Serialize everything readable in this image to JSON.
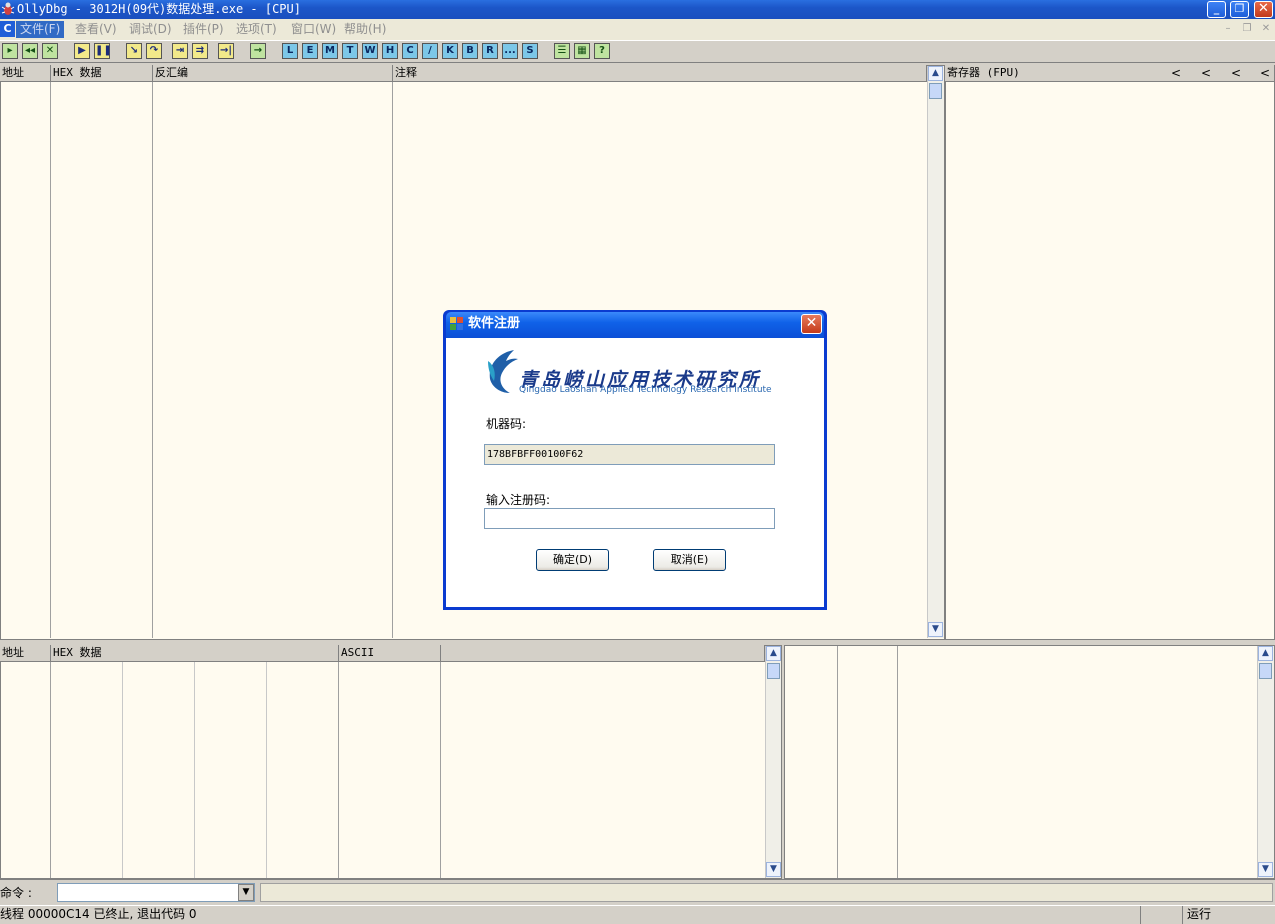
{
  "window": {
    "title": "OllyDbg - 3012H(09代)数据处理.exe - [CPU]",
    "buttons": {
      "minimize": "_",
      "restore": "❐",
      "close": "✕"
    }
  },
  "menu": {
    "mdi_icon": "C",
    "items": [
      "文件(F)",
      "查看(V)",
      "调试(D)",
      "插件(P)",
      "选项(T)",
      "窗口(W)",
      "帮助(H)"
    ],
    "mdi_controls": [
      "–",
      "❐",
      "✕"
    ]
  },
  "toolbar": {
    "buttons": [
      {
        "label": "▸",
        "name": "open-icon"
      },
      {
        "label": "◂◂",
        "name": "restart-icon"
      },
      {
        "label": "✕",
        "name": "close-program-icon"
      },
      {
        "label": "▶",
        "name": "run-icon"
      },
      {
        "label": "❚❚",
        "name": "pause-icon"
      },
      {
        "label": "↘",
        "name": "step-into-icon"
      },
      {
        "label": "↷",
        "name": "step-over-icon"
      },
      {
        "label": "⇥",
        "name": "trace-into-icon"
      },
      {
        "label": "⇉",
        "name": "trace-over-icon"
      },
      {
        "label": "→|",
        "name": "execute-till-return-icon"
      },
      {
        "label": "→",
        "name": "go-to-icon"
      },
      {
        "label": "L",
        "name": "log-window-icon"
      },
      {
        "label": "E",
        "name": "modules-icon"
      },
      {
        "label": "M",
        "name": "memory-map-icon"
      },
      {
        "label": "T",
        "name": "threads-icon"
      },
      {
        "label": "W",
        "name": "windows-icon"
      },
      {
        "label": "H",
        "name": "handles-icon"
      },
      {
        "label": "C",
        "name": "cpu-icon"
      },
      {
        "label": "/",
        "name": "patches-icon"
      },
      {
        "label": "K",
        "name": "call-stack-icon"
      },
      {
        "label": "B",
        "name": "breakpoints-icon"
      },
      {
        "label": "R",
        "name": "references-icon"
      },
      {
        "label": "...",
        "name": "run-trace-icon"
      },
      {
        "label": "S",
        "name": "source-icon"
      },
      {
        "label": "☰",
        "name": "list-icon"
      },
      {
        "label": "▦",
        "name": "appearance-icon"
      },
      {
        "label": "?",
        "name": "help-icon"
      }
    ]
  },
  "disasm_pane": {
    "headers": [
      "地址",
      "HEX 数据",
      "反汇编",
      "注释"
    ]
  },
  "registers_pane": {
    "header": "寄存器 (FPU)",
    "arrows": [
      "<",
      "<",
      "<",
      "<"
    ]
  },
  "dump_pane": {
    "headers": [
      "地址",
      "HEX 数据",
      "ASCII"
    ]
  },
  "command": {
    "label": "命令 :"
  },
  "status": {
    "text": "线程 00000C14 已终止, 退出代码 0",
    "state": "运行"
  },
  "dialog": {
    "title": "软件注册",
    "close": "✕",
    "logo_title": "青岛崂山应用技术研究所",
    "logo_subtitle": "Qingdao Laoshan Applied Technology Research Institute",
    "machine_code_label": "机器码:",
    "machine_code_value": "178BFBFF00100F62",
    "reg_code_label": "输入注册码:",
    "reg_code_value": "",
    "ok_label": "确定(D)",
    "cancel_label": "取消(E)"
  },
  "scroll": {
    "up": "▲",
    "down": "▼"
  }
}
